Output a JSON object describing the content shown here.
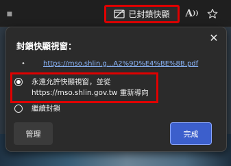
{
  "toolbar": {
    "blocked_chip_label": "已封鎖快顯",
    "read_aloud_label": "A"
  },
  "popup": {
    "title": "封鎖快顯視窗：",
    "blocked_url": "https://mso.shlin.g...A2%9D%E4%BE%8B.pdf",
    "options": [
      {
        "label": "永遠允許快顯視窗，並從 https://mso.shlin.gov.tw 重新導向",
        "selected": true
      },
      {
        "label": "繼續封鎖",
        "selected": false
      }
    ],
    "manage_label": "管理",
    "done_label": "完成"
  },
  "colors": {
    "highlight": "#e00000",
    "link": "#8ab4f8",
    "primary_button": "#3c5fcc"
  },
  "icons": [
    "popup-blocked-icon",
    "read-aloud-icon",
    "favorite-star-icon",
    "close-icon",
    "radio-selected-icon",
    "radio-unselected-icon"
  ]
}
